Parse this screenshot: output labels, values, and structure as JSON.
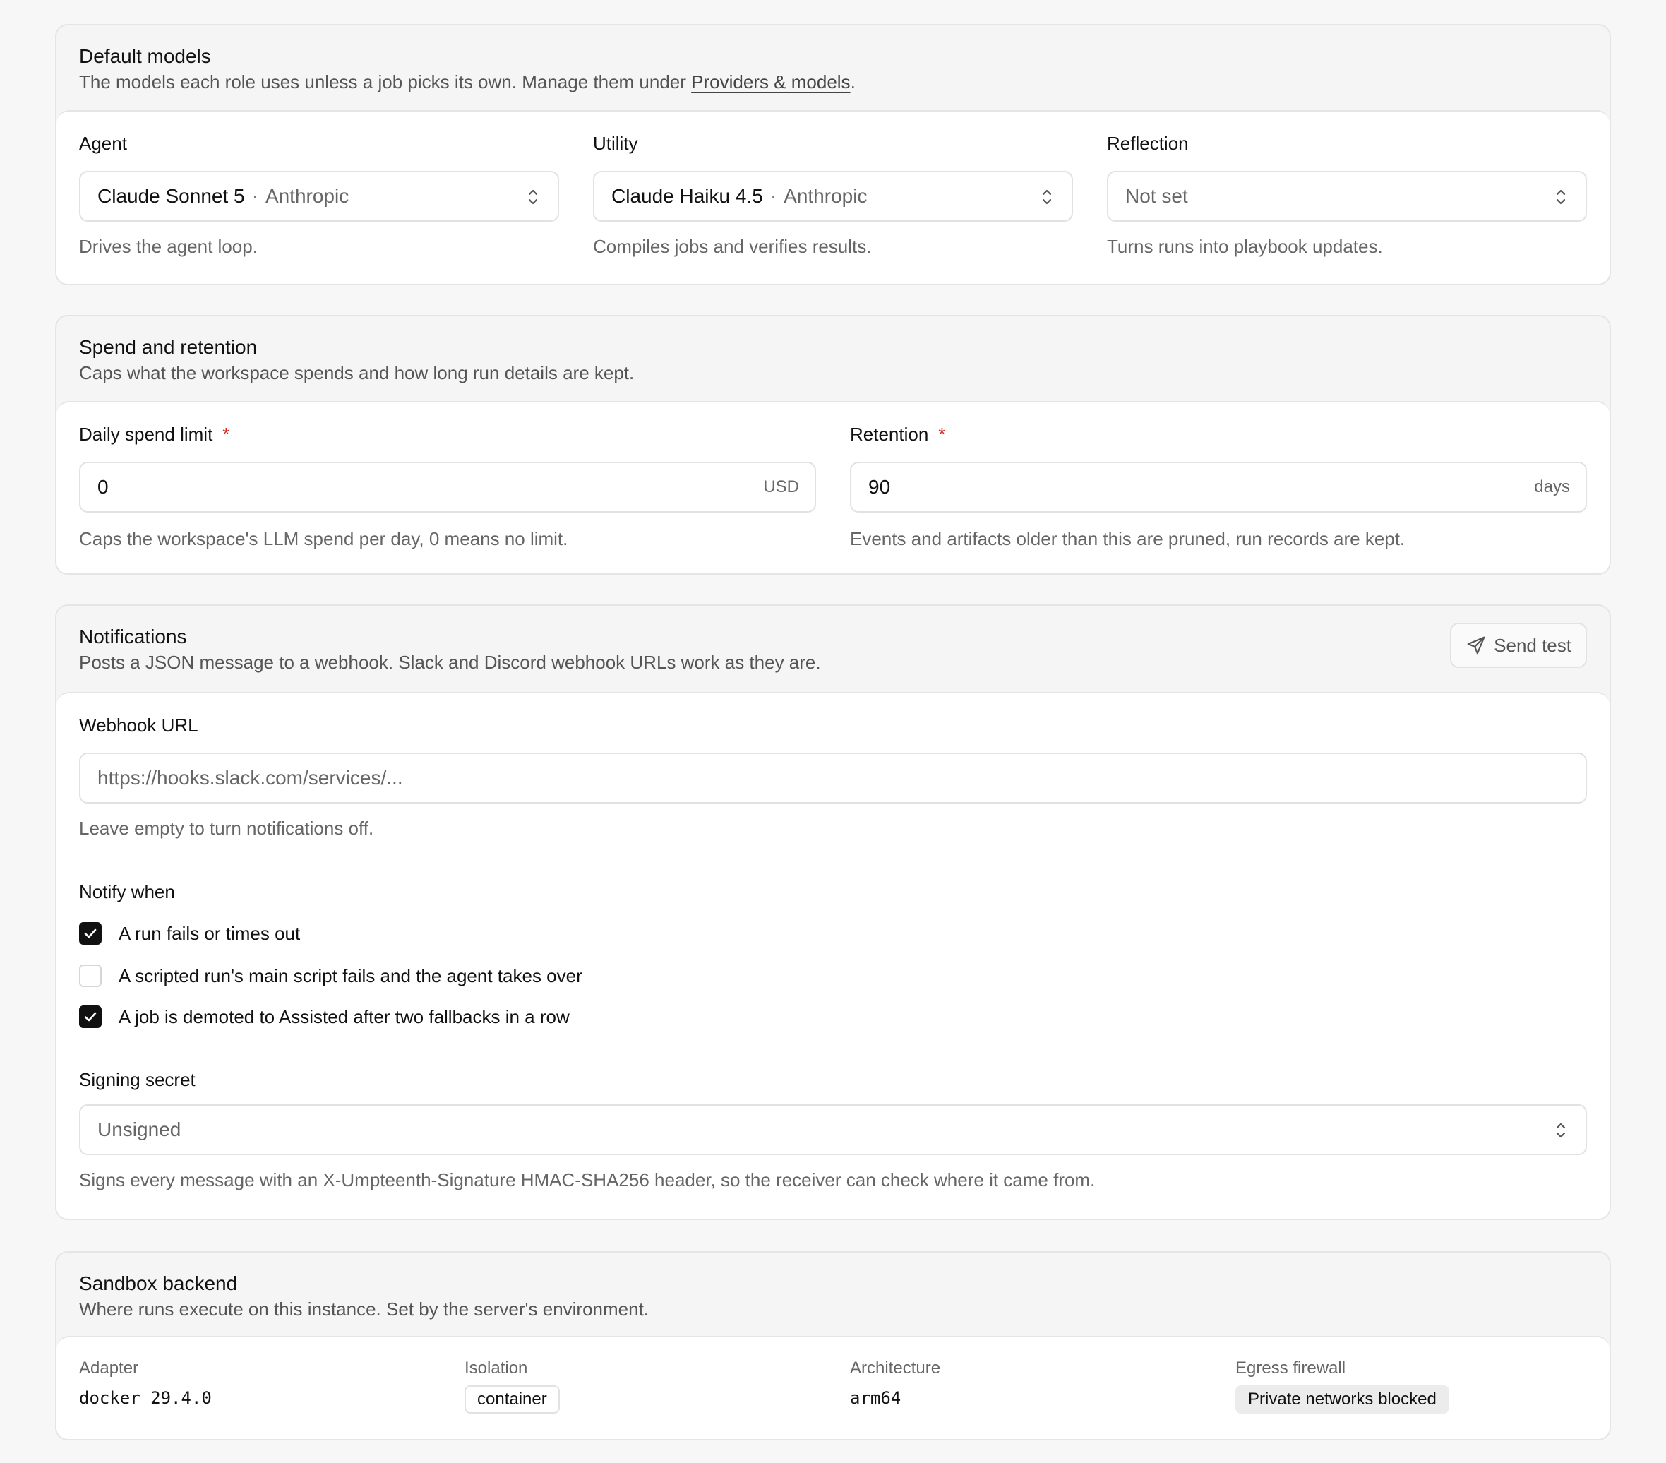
{
  "default_models": {
    "title": "Default models",
    "subtitle_prefix": "The models each role uses unless a job picks its own. Manage them under ",
    "subtitle_link": "Providers & models",
    "subtitle_suffix": ".",
    "agent": {
      "label": "Agent",
      "model": "Claude Sonnet 5",
      "provider": "Anthropic",
      "help": "Drives the agent loop."
    },
    "utility": {
      "label": "Utility",
      "model": "Claude Haiku 4.5",
      "provider": "Anthropic",
      "help": "Compiles jobs and verifies results."
    },
    "reflection": {
      "label": "Reflection",
      "value": "Not set",
      "help": "Turns runs into playbook updates."
    }
  },
  "spend_retention": {
    "title": "Spend and retention",
    "subtitle": "Caps what the workspace spends and how long run details are kept.",
    "daily_limit": {
      "label": "Daily spend limit",
      "value": "0",
      "suffix": "USD",
      "help": "Caps the workspace's LLM spend per day, 0 means no limit."
    },
    "retention": {
      "label": "Retention",
      "value": "90",
      "suffix": "days",
      "help": "Events and artifacts older than this are pruned, run records are kept."
    },
    "required_mark": "*"
  },
  "notifications": {
    "title": "Notifications",
    "subtitle": "Posts a JSON message to a webhook. Slack and Discord webhook URLs work as they are.",
    "send_test_label": "Send test",
    "webhook": {
      "label": "Webhook URL",
      "placeholder": "https://hooks.slack.com/services/...",
      "help": "Leave empty to turn notifications off."
    },
    "notify_when_label": "Notify when",
    "options": [
      {
        "label": "A run fails or times out",
        "checked": true
      },
      {
        "label": "A scripted run's main script fails and the agent takes over",
        "checked": false
      },
      {
        "label": "A job is demoted to Assisted after two fallbacks in a row",
        "checked": true
      }
    ],
    "signing": {
      "label": "Signing secret",
      "value": "Unsigned",
      "help": "Signs every message with an X-Umpteenth-Signature HMAC-SHA256 header, so the receiver can check where it came from."
    }
  },
  "sandbox": {
    "title": "Sandbox backend",
    "subtitle": "Where runs execute on this instance. Set by the server's environment.",
    "adapter": {
      "label": "Adapter",
      "value": "docker 29.4.0"
    },
    "isolation": {
      "label": "Isolation",
      "value": "container"
    },
    "architecture": {
      "label": "Architecture",
      "value": "arm64"
    },
    "egress": {
      "label": "Egress firewall",
      "value": "Private networks blocked"
    }
  }
}
